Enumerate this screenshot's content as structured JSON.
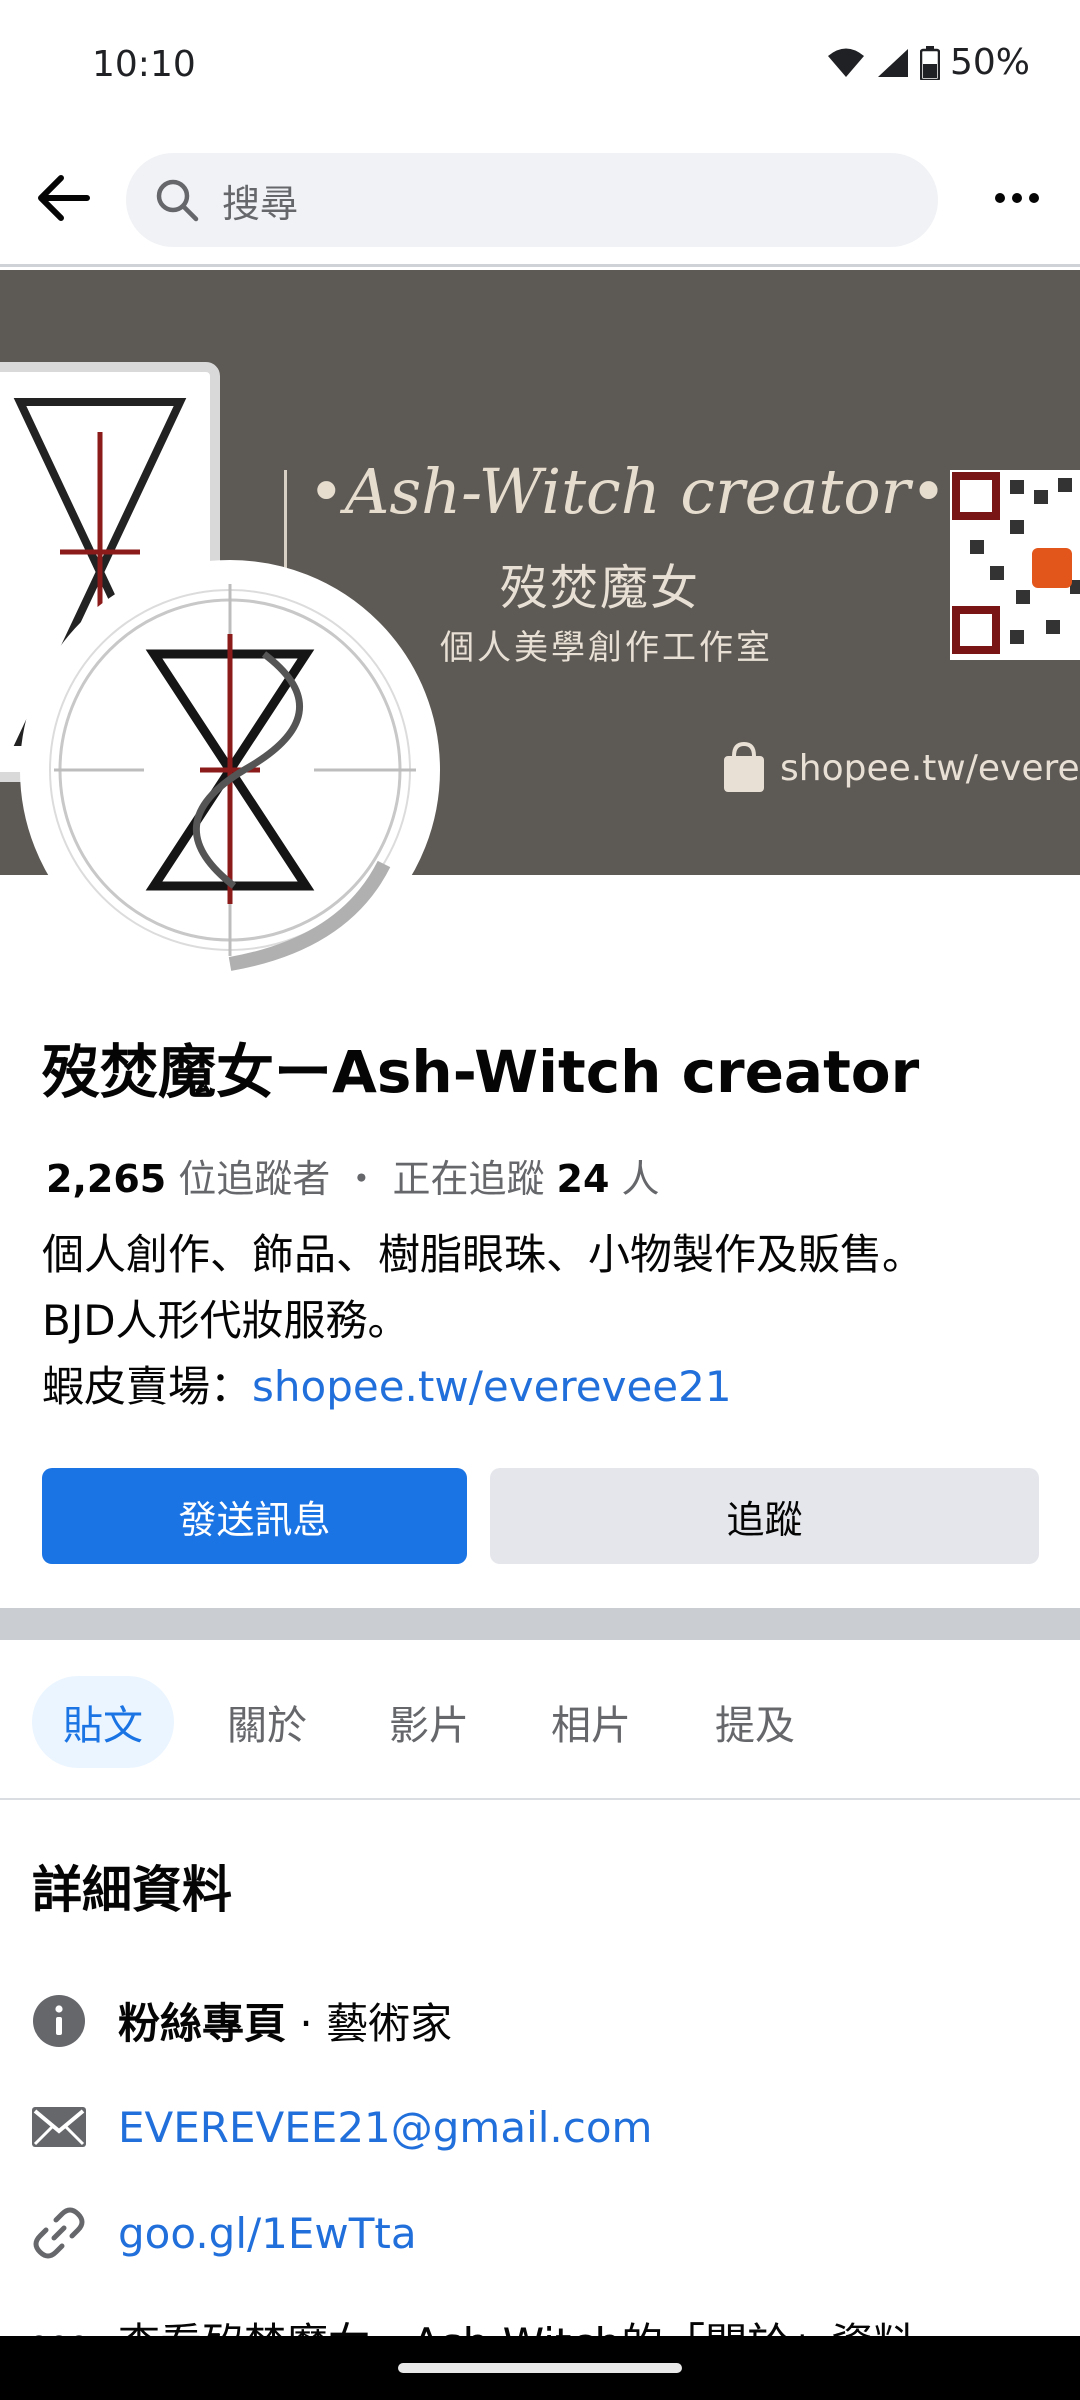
{
  "status_bar": {
    "time": "10:10",
    "battery": "50%"
  },
  "search": {
    "placeholder": "搜尋"
  },
  "cover": {
    "title": "•Ash-Witch creator•",
    "subtitle": "歿焚魔女",
    "tagline": "個人美學創作工作室",
    "shop_url": "shopee.tw/evereve"
  },
  "profile": {
    "name": "歿焚魔女ーAsh-Witch creator",
    "followers_count": "2,265",
    "followers_label": " 位追蹤者 ・ 正在追蹤 ",
    "following_count": "24",
    "following_suffix": " 人",
    "bio_line1": "個人創作、飾品、樹脂眼珠、小物製作及販售。",
    "bio_line2": "BJD人形代妝服務。",
    "bio_line3_prefix": "蝦皮賣場：",
    "bio_line3_link": "shopee.tw/everevee21"
  },
  "actions": {
    "message": "發送訊息",
    "follow": "追蹤"
  },
  "tabs": [
    "貼文",
    "關於",
    "影片",
    "相片",
    "提及"
  ],
  "details": {
    "title": "詳細資料",
    "category_bold": "粉絲專頁",
    "category_rest": " · 藝術家",
    "email": "EVEREVEE21@gmail.com",
    "website": "goo.gl/1EwTta",
    "more": "查看歿焚魔女ーAsh-Witch的「關於」資料"
  },
  "colors": {
    "primary": "#1b74e4",
    "link": "#216fdb",
    "cover_bg": "#5d5955"
  }
}
